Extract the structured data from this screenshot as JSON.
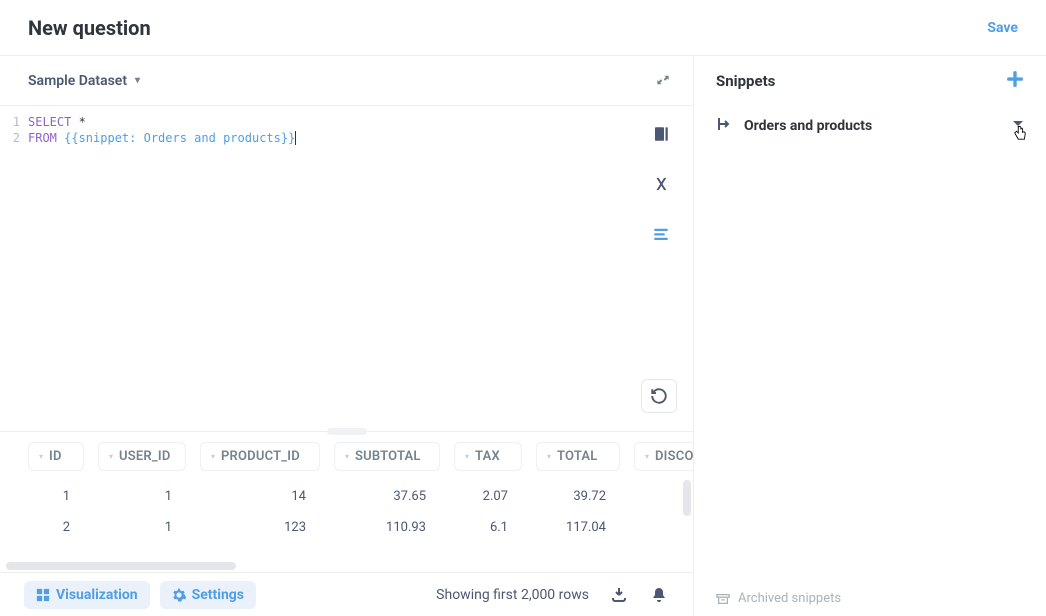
{
  "header": {
    "title": "New question",
    "save_label": "Save"
  },
  "database": {
    "name": "Sample Dataset"
  },
  "editor": {
    "lines": [
      "1",
      "2"
    ],
    "code_line1_kw1": "SELECT",
    "code_line1_rest": " *",
    "code_line2_kw1": "FROM",
    "code_line2_snippet": " {{snippet: Orders and products}}"
  },
  "tools": {
    "data_reference": "data-reference-icon",
    "variables": "variables-icon",
    "snippets": "snippets-icon",
    "run": "refresh-icon"
  },
  "results": {
    "columns": [
      "ID",
      "USER_ID",
      "PRODUCT_ID",
      "SUBTOTAL",
      "TAX",
      "TOTAL",
      "DISCO"
    ],
    "rows": [
      [
        "1",
        "1",
        "14",
        "37.65",
        "2.07",
        "39.72",
        ""
      ],
      [
        "2",
        "1",
        "123",
        "110.93",
        "6.1",
        "117.04",
        ""
      ]
    ]
  },
  "footer": {
    "visualization_label": "Visualization",
    "settings_label": "Settings",
    "status": "Showing first 2,000 rows"
  },
  "snippets_panel": {
    "title": "Snippets",
    "items": [
      {
        "name": "Orders and products"
      }
    ],
    "archived_label": "Archived snippets"
  }
}
